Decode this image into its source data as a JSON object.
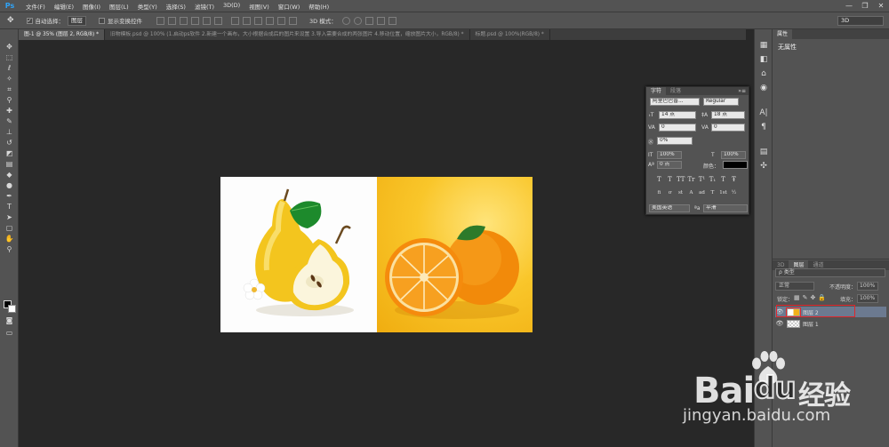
{
  "app": {
    "logo": "Ps"
  },
  "menu": [
    "文件(F)",
    "编辑(E)",
    "图像(I)",
    "图层(L)",
    "类型(Y)",
    "选择(S)",
    "滤镜(T)",
    "3D(D)",
    "视图(V)",
    "窗口(W)",
    "帮助(H)"
  ],
  "window_controls": {
    "minimize": "—",
    "restore": "❐",
    "close": "✕"
  },
  "options_bar": {
    "auto_select_label": "自动选择：",
    "auto_select_value": "图层",
    "show_transform_label": "显示变换控件",
    "mode_3d_label": "3D 模式：",
    "workspace": "3D"
  },
  "doc_tabs": [
    {
      "label": "图-1 @ 35% (图层 2, RGB/8) *",
      "active": true
    },
    {
      "label": "旧物模板.psd @ 100% (1.启动ps软件 2.新建一个画布，大小根据合成后的图片来设置 3.导入需要合成的两张图片 4.移动位置，缩放图片大小，RGB/8) *",
      "active": false
    },
    {
      "label": "标题.psd @ 100%(RGB/8) *",
      "active": false
    }
  ],
  "tools": [
    "move",
    "marquee",
    "lasso",
    "magic-wand",
    "crop",
    "eyedropper",
    "healing",
    "brush",
    "stamp",
    "history-brush",
    "eraser",
    "gradient",
    "blur",
    "dodge",
    "pen",
    "type",
    "path-select",
    "shape",
    "hand",
    "zoom"
  ],
  "properties_panel": {
    "tabs": [
      "属性"
    ],
    "content": "无属性"
  },
  "character_panel": {
    "tabs": [
      "字符",
      "段落"
    ],
    "font_family": "阿里巴巴普...",
    "font_style": "Regular",
    "font_size": "14 点",
    "leading": "18 点",
    "kerning": "0",
    "tracking": "0",
    "scale_label": "0%",
    "vertical_scale": "100%",
    "horizontal_scale": "100%",
    "baseline": "0 点",
    "color_label": "颜色：",
    "text_styles": [
      "T",
      "T",
      "TT",
      "Tr",
      "T¹",
      "T₁",
      "T",
      "Ŧ"
    ],
    "opentype": [
      "fi",
      "ơ",
      "st",
      "A",
      "ad",
      "T",
      "1st",
      "½"
    ],
    "language": "美国英语",
    "antialias": "平滑"
  },
  "layers_panel": {
    "tabs": [
      "3D",
      "图层",
      "通道"
    ],
    "filter_kind": "ρ 类型",
    "blend_mode": "正常",
    "opacity_label": "不透明度：",
    "opacity": "100%",
    "lock_label": "锁定：",
    "fill_label": "填充：",
    "fill": "100%",
    "layers": [
      {
        "name": "图层 2",
        "selected": true
      },
      {
        "name": "图层 1",
        "selected": false
      }
    ]
  },
  "watermark": {
    "brand": "Bai",
    "brand_suffix": "du",
    "cn": "经验",
    "url": "jingyan.baidu.com"
  },
  "colors": {
    "ui_bg": "#535353",
    "canvas_bg": "#282828",
    "highlight": "#e0262b",
    "selected_layer": "#6c7a90"
  }
}
